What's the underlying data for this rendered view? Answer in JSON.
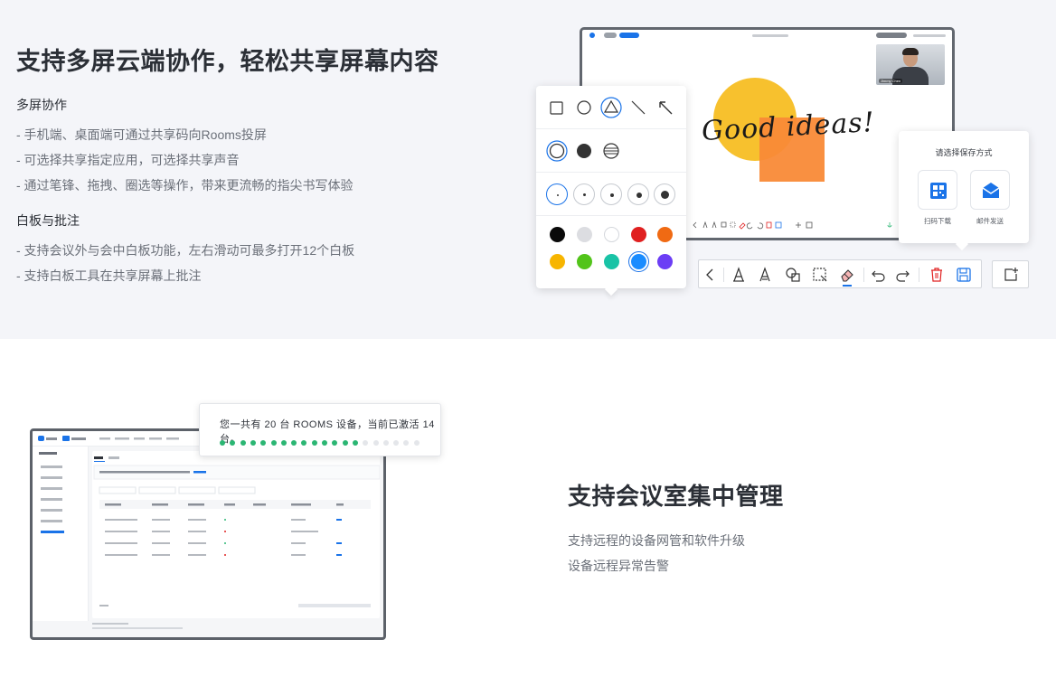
{
  "top": {
    "title": "支持多屏云端协作，轻松共享屏幕内容",
    "group1": {
      "heading": "多屏协作",
      "items": [
        "- 手机端、桌面端可通过共享码向Rooms投屏",
        "- 可选择共享指定应用，可选择共享声音",
        "- 通过笔锋、拖拽、圈选等操作，带来更流畅的指尖书写体验"
      ]
    },
    "group2": {
      "heading": "白板与批注",
      "items": [
        "- 支持会议外与会中白板功能，左右滑动可最多打开12个白板",
        "- 支持白板工具在共享屏幕上批注"
      ]
    },
    "whiteboard_text": "Good ideas!",
    "participant_name": "Jimmy Chen",
    "save_dialog": {
      "title": "请选择保存方式",
      "option_qr": "扫码下载",
      "option_mail": "邮件发送"
    },
    "pen_colors": [
      "#0a0a0a",
      "#dcdde1",
      "#ffffff",
      "#e02020",
      "#f06a13",
      "#f7b500",
      "#52c41a",
      "#19c3a6",
      "#1a8cff",
      "#6c3ef5"
    ],
    "accent": "#1a73e8"
  },
  "bottom": {
    "title": "支持会议室集中管理",
    "items": [
      "支持远程的设备网管和软件升级",
      "设备远程异常告警"
    ],
    "device_card": {
      "text": "您一共有 20 台 ROOMS 设备，当前已激活 14 台。",
      "total": 20,
      "active": 14,
      "active_color": "#2bb673",
      "inactive_color": "#e4e6ea"
    }
  }
}
